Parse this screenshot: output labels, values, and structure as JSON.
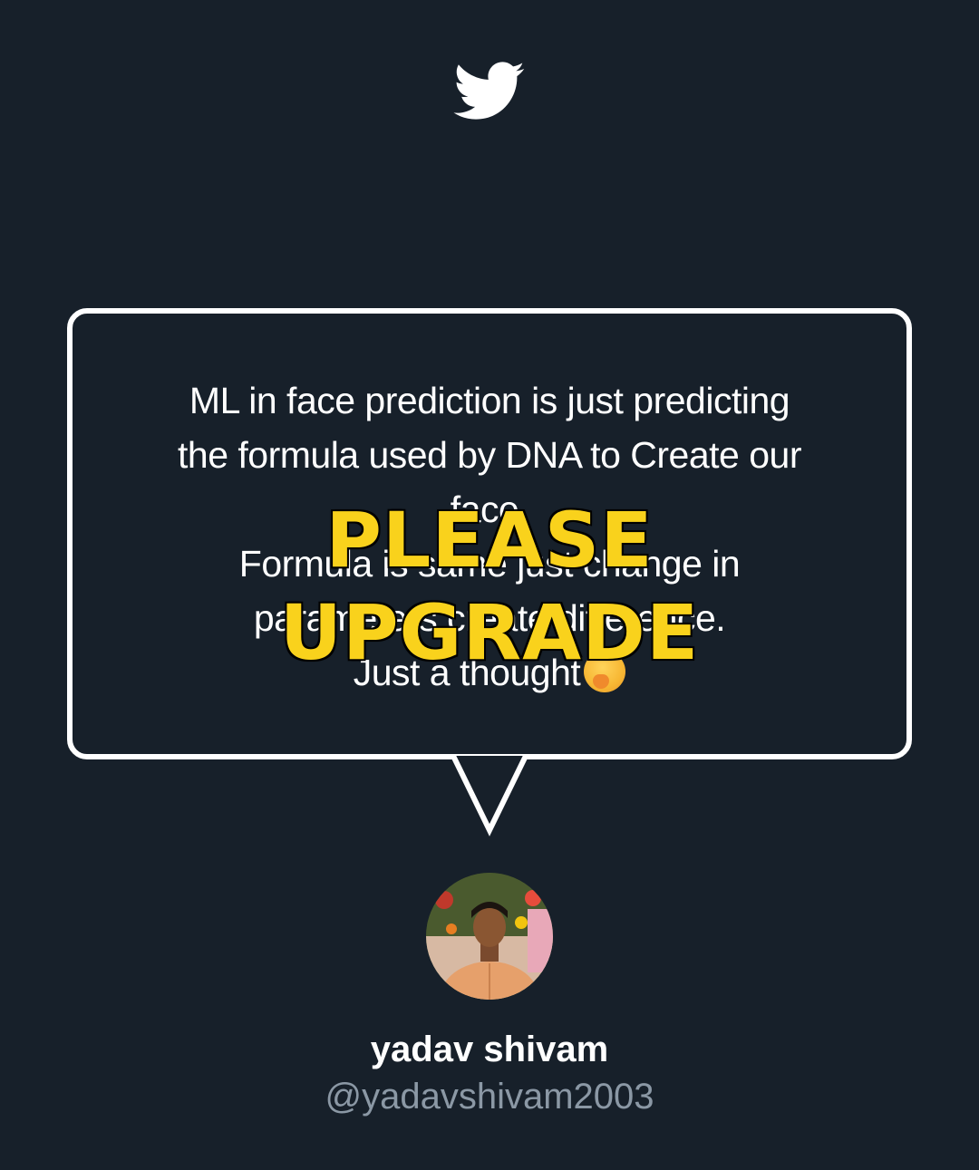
{
  "header": {
    "logo_icon": "twitter-bird-icon"
  },
  "tweet": {
    "lines": [
      "ML in face prediction is just predicting",
      "the formula used by DNA  to Create our",
      "face.",
      "Formula is same just change in",
      "parameters create difference.",
      "Just a thought"
    ],
    "emoji_icon": "thinking-face-emoji"
  },
  "watermark": {
    "line1": "PLEASE",
    "line2": "UPGRADE",
    "color": "#f9d21c"
  },
  "author": {
    "avatar_icon": "profile-photo",
    "name": "yadav shivam",
    "handle": "@yadavshivam2003"
  },
  "colors": {
    "background": "#17202a",
    "text": "#ffffff",
    "handle": "#8b98a5"
  }
}
